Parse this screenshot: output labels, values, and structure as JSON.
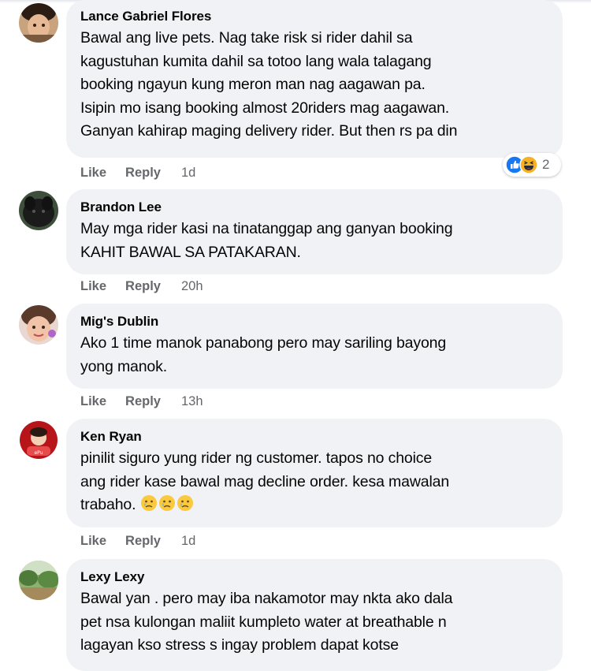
{
  "comments": [
    {
      "author": "Lance Gabriel Flores",
      "text": "Bawal ang live pets. Nag take risk si rider dahil sa\nkagustuhan kumita dahil sa totoo lang wala talagang\nbooking ngayun kung meron man nag aagawan pa.\nIsipin mo isang booking almost 20riders mag aagawan.\nGanyan kahirap maging delivery rider. But then rs pa din",
      "like_label": "Like",
      "reply_label": "Reply",
      "time": "1d",
      "reactions": {
        "types": [
          "like-icon",
          "haha-icon"
        ],
        "count": "2"
      }
    },
    {
      "author": "Brandon Lee",
      "text": "May mga rider kasi na tinatanggap ang ganyan booking\nKAHIT BAWAL SA PATAKARAN.",
      "like_label": "Like",
      "reply_label": "Reply",
      "time": "20h"
    },
    {
      "author": "Mig's Dublin",
      "text": "Ako 1 time manok panabong pero may sariling bayong\nyong manok.",
      "like_label": "Like",
      "reply_label": "Reply",
      "time": "13h"
    },
    {
      "author": "Ken Ryan",
      "text": "pinilit siguro yung rider ng customer. tapos no choice\nang rider kase bawal mag decline order. kesa mawalan\ntrabaho.",
      "emojis": [
        "sad-tear-emoji",
        "sad-tear-emoji",
        "sad-tear-emoji"
      ],
      "like_label": "Like",
      "reply_label": "Reply",
      "time": "1d"
    },
    {
      "author": "Lexy Lexy",
      "text": "Bawal yan . pero may iba nakamotor may nkta ako dala\npet nsa kulongan maliit kumpleto water at breathable n\nlagayan kso stress s ingay problem dapat kotse"
    }
  ],
  "colors": {
    "bubble": "#f0f2f5",
    "text": "#050505",
    "secondary": "#65676b",
    "like_blue": "#1877f2",
    "haha_yellow": "#f7b125"
  }
}
